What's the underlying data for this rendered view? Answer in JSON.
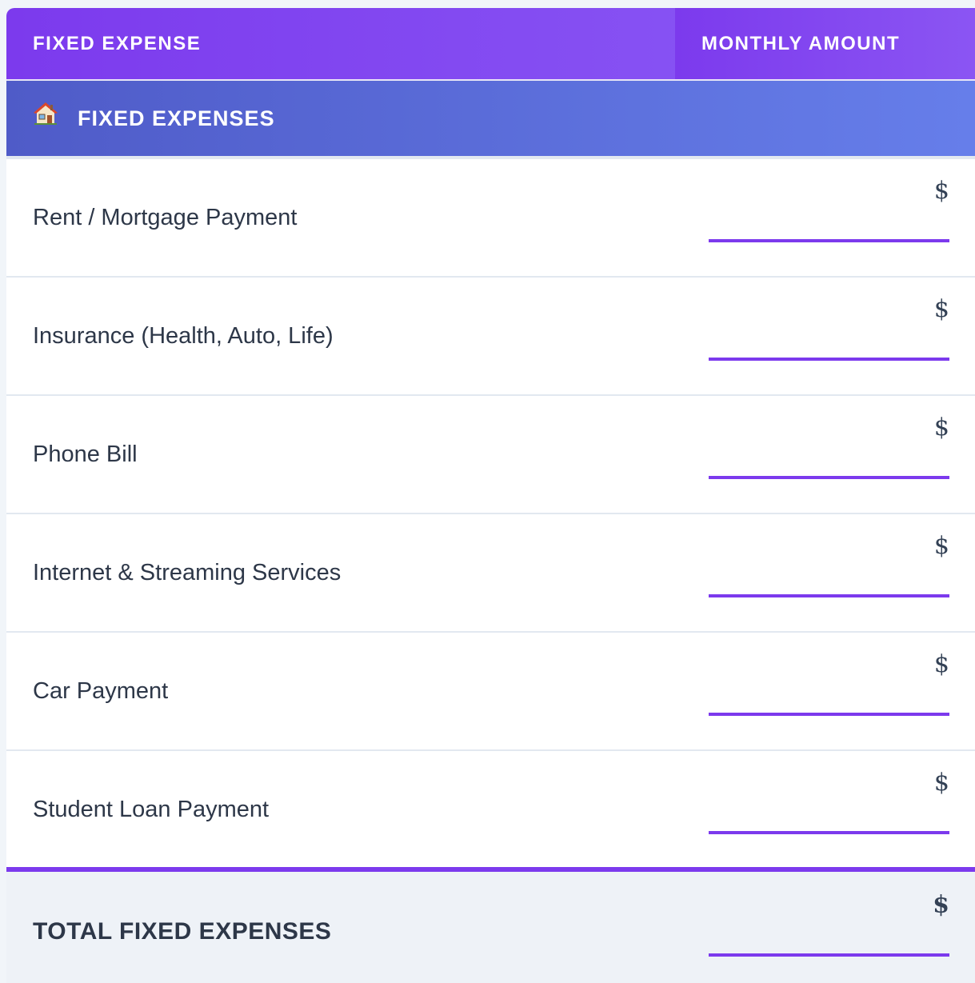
{
  "header": {
    "col_expense": "FIXED EXPENSE",
    "col_amount": "MONTHLY AMOUNT"
  },
  "section": {
    "icon": "house-icon",
    "title": "FIXED EXPENSES"
  },
  "rows": [
    {
      "label": "Rent / Mortgage Payment",
      "currency": "$",
      "value": ""
    },
    {
      "label": "Insurance (Health, Auto, Life)",
      "currency": "$",
      "value": ""
    },
    {
      "label": "Phone Bill",
      "currency": "$",
      "value": ""
    },
    {
      "label": "Internet & Streaming Services",
      "currency": "$",
      "value": ""
    },
    {
      "label": "Car Payment",
      "currency": "$",
      "value": ""
    },
    {
      "label": "Student Loan Payment",
      "currency": "$",
      "value": ""
    }
  ],
  "total": {
    "label": "TOTAL FIXED EXPENSES",
    "currency": "$",
    "value": ""
  },
  "colors": {
    "accent": "#7c3aed",
    "section_start": "#4f5bc8",
    "section_end": "#667eea",
    "text": "#2d3748"
  }
}
